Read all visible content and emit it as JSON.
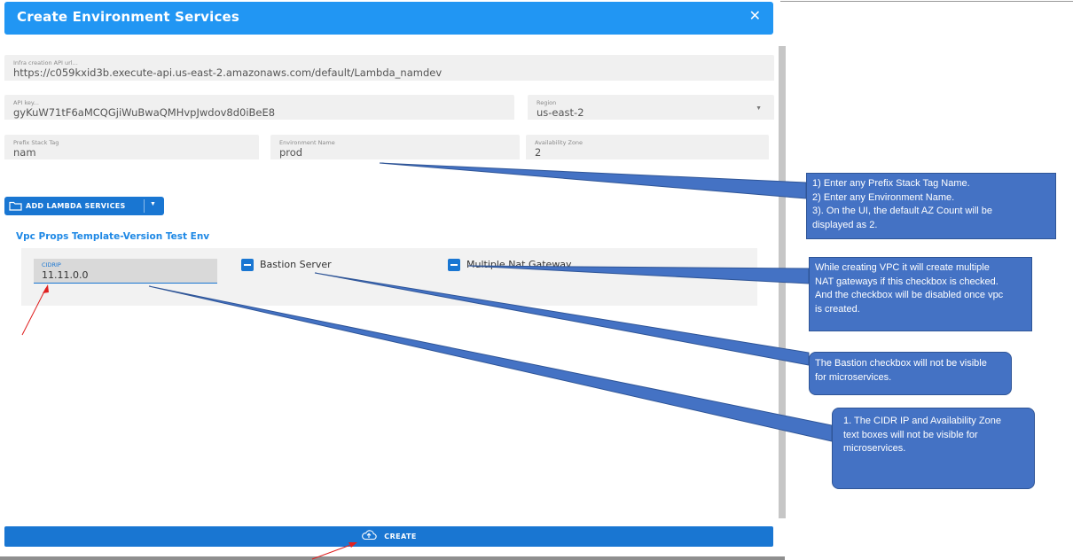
{
  "dialog": {
    "title": "Create Environment Services",
    "close_glyph": "✕"
  },
  "fields": {
    "api_url": {
      "label": "Infra creation API url...",
      "value": "https://c059kxid3b.execute-api.us-east-2.amazonaws.com/default/Lambda_namdev"
    },
    "api_key": {
      "label": "API key...",
      "value": "gyKuW71tF6aMCQGjiWuBwaQMHvpJwdov8d0iBeE8"
    },
    "region": {
      "label": "Region",
      "value": "us-east-2",
      "icon": "caret-down-icon"
    },
    "prefix_stack_tag": {
      "label": "Prefix Stack Tag",
      "value": "nam"
    },
    "environment_name": {
      "label": "Environment Name",
      "value": "prod"
    },
    "availability_zone": {
      "label": "Availability Zone",
      "value": "2"
    }
  },
  "add_lambda": {
    "label": "ADD LAMBDA SERVICES",
    "icon": "folder-icon",
    "dropdown_icon": "caret-down-icon"
  },
  "vpc": {
    "title": "Vpc Props Template-Version Test Env",
    "cidr": {
      "label": "CIDRIP",
      "value": "11.11.0.0"
    },
    "bastion_label": "Bastion Server",
    "multi_nat_label": "Multiple Nat Gateway"
  },
  "create": {
    "label": "CREATE",
    "icon": "cloud-upload-icon"
  },
  "annotations": {
    "callout1": [
      "1) Enter any Prefix Stack Tag Name.",
      "2) Enter any Environment Name.",
      "3). On the UI, the default AZ Count will be",
      "displayed as 2."
    ],
    "callout2": [
      "While creating VPC it will create multiple",
      "NAT gateways if this checkbox is checked.",
      "And the checkbox will be disabled once vpc",
      "is created."
    ],
    "callout3": [
      "The Bastion checkbox will not be visible",
      "for microservices."
    ],
    "callout4": [
      "1. The CIDR IP and Availability Zone",
      "text boxes will not be visible for",
      "microservices."
    ]
  },
  "colors": {
    "header_bg": "#2196f3",
    "button_bg": "#1976d2",
    "callout_bg": "#4472c4",
    "annotation_red": "#e02020"
  }
}
